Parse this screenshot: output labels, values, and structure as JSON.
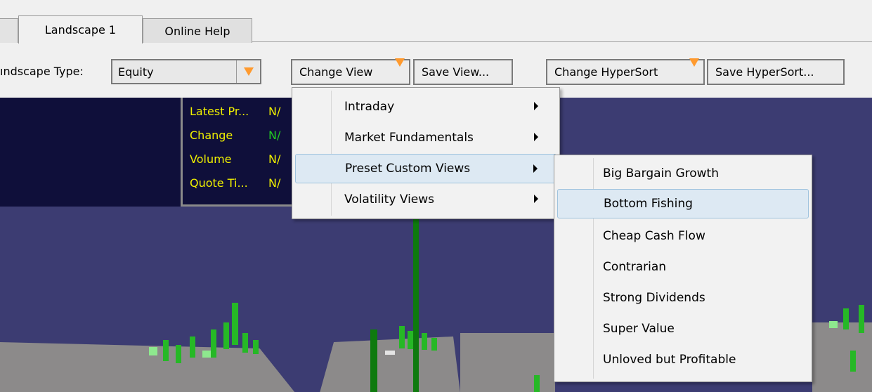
{
  "tabs": [
    {
      "label": "Landscape 1",
      "active": true
    },
    {
      "label": "Online Help",
      "active": false
    }
  ],
  "toolbar": {
    "landscape_type_label": "ındscape Type:",
    "landscape_type_value": "Equity",
    "change_view": "Change View",
    "save_view": "Save View...",
    "change_hypersort": "Change HyperSort",
    "save_hypersort": "Save HyperSort..."
  },
  "quote": {
    "latest_price_label": "Latest Pr...",
    "latest_price_value": "N/",
    "change_label": "Change",
    "change_value": "N/",
    "volume_label": "Volume",
    "volume_value": "N/",
    "quote_time_label": "Quote Ti...",
    "quote_time_value": "N/"
  },
  "menu": {
    "items": [
      "Intraday",
      "Market Fundamentals",
      "Preset Custom Views",
      "Volatility Views"
    ],
    "highlighted": "Preset Custom Views"
  },
  "submenu": {
    "items": [
      "Big Bargain Growth",
      "Bottom Fishing",
      "Cheap Cash Flow",
      "Contrarian",
      "Strong Dividends",
      "Super Value",
      "Unloved but Profitable"
    ],
    "highlighted": "Bottom Fishing"
  },
  "colors": {
    "scene_background": "#3c3c72",
    "panel_background": "#0f0f3a",
    "label_yellow": "#f0f000",
    "change_green": "#22cc22",
    "dropdown_orange": "#ff9a2e",
    "menu_highlight": "#dde9f3"
  }
}
